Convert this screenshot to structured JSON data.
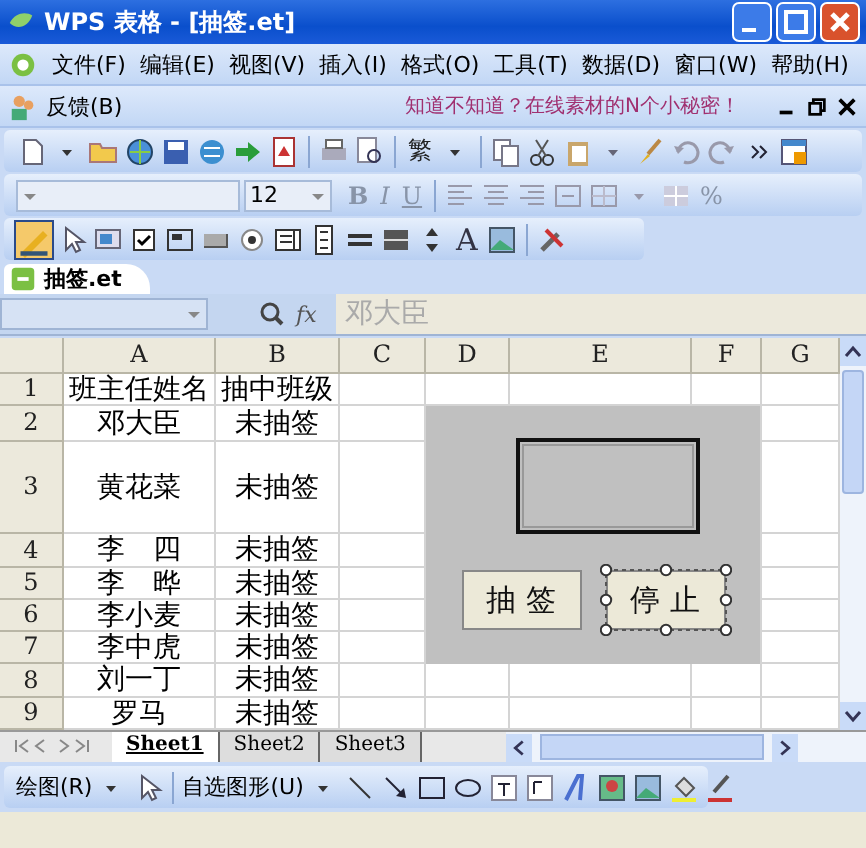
{
  "window": {
    "title": "WPS 表格 - [抽签.et]"
  },
  "menu": [
    "文件(F)",
    "编辑(E)",
    "视图(V)",
    "插入(I)",
    "格式(O)",
    "工具(T)",
    "数据(D)",
    "窗口(W)",
    "帮助(H)"
  ],
  "feedback": {
    "label": "反馈(B)",
    "tip": "知道不知道？在线素材的N个小秘密！"
  },
  "standard_toolbar": {
    "traditional_chinese": "繁"
  },
  "format_toolbar": {
    "font_size": "12",
    "bold": "B",
    "italic": "I",
    "underline": "U",
    "percent": "%"
  },
  "controls_toolbar": {
    "design_mode_on": true,
    "label_tool": "A"
  },
  "document_tab": "抽签.et",
  "formula_bar": {
    "fx": "fx",
    "content": "邓大臣"
  },
  "columns": [
    "A",
    "B",
    "C",
    "D",
    "E",
    "F",
    "G"
  ],
  "rows": [
    {
      "number": "1",
      "cells": [
        "班主任姓名",
        "抽中班级"
      ]
    },
    {
      "number": "2",
      "cells": [
        "邓大臣",
        "未抽签"
      ]
    },
    {
      "number": "3",
      "cells": [
        "黄花菜",
        "未抽签"
      ]
    },
    {
      "number": "4",
      "cells": [
        "李　四",
        "未抽签"
      ]
    },
    {
      "number": "5",
      "cells": [
        "李　晔",
        "未抽签"
      ]
    },
    {
      "number": "6",
      "cells": [
        "李小麦",
        "未抽签"
      ]
    },
    {
      "number": "7",
      "cells": [
        "李中虎",
        "未抽签"
      ]
    },
    {
      "number": "8",
      "cells": [
        "刘一丁",
        "未抽签"
      ]
    },
    {
      "number": "9",
      "cells": [
        "罗马",
        "未抽签"
      ]
    }
  ],
  "form": {
    "buttons": [
      {
        "label": "抽 签",
        "selected": false
      },
      {
        "label": "停 止",
        "selected": true
      }
    ]
  },
  "sheet_tabs": [
    {
      "label": "Sheet1",
      "selected": true
    },
    {
      "label": "Sheet2",
      "selected": false
    },
    {
      "label": "Sheet3",
      "selected": false
    }
  ],
  "drawing_toolbar": {
    "draw_menu": "绘图(R)",
    "autoshapes": "自选图形(U)"
  }
}
